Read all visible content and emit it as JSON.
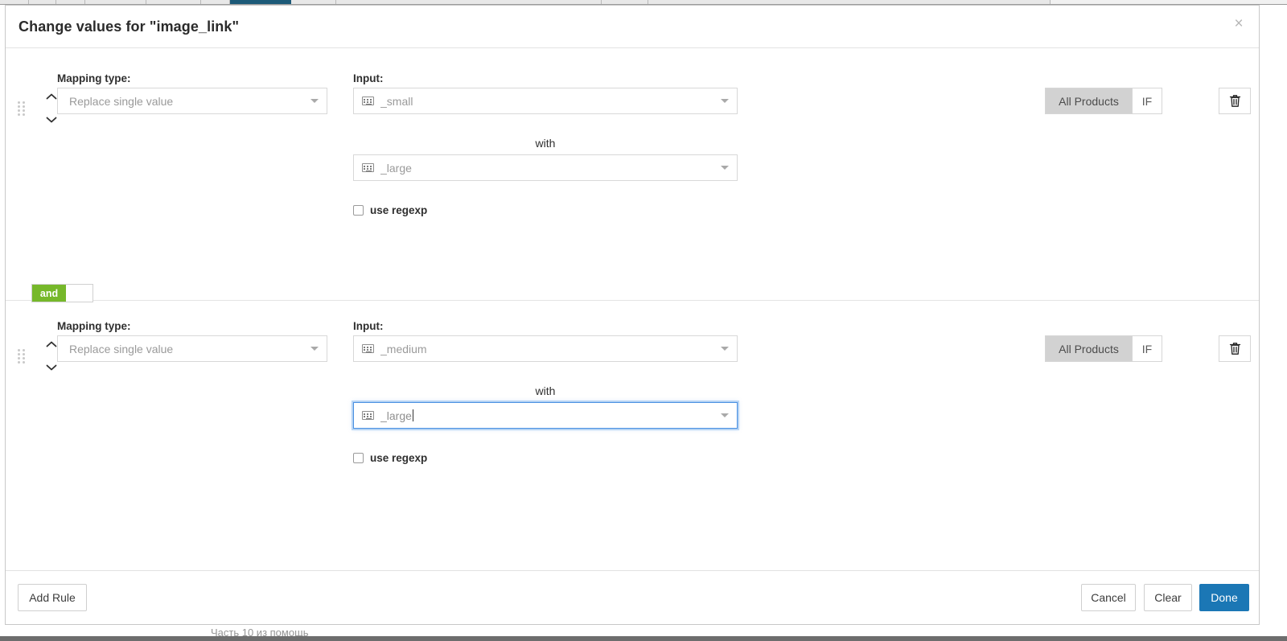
{
  "window": {
    "title": "Change values for \"image_link\"",
    "close_label": "×"
  },
  "labels": {
    "mapping_type": "Mapping type:",
    "input": "Input:",
    "with": "with",
    "use_regexp": "use regexp"
  },
  "rules": [
    {
      "mapping_type": "Replace single value",
      "input_value": "_small",
      "with_value": "_large",
      "use_regexp_checked": false,
      "scope_all_label": "All Products",
      "scope_if_label": "IF",
      "scope_active": "All Products",
      "focused": false
    },
    {
      "mapping_type": "Replace single value",
      "input_value": "_medium",
      "with_value": "_large",
      "use_regexp_checked": false,
      "scope_all_label": "All Products",
      "scope_if_label": "IF",
      "scope_active": "All Products",
      "focused": true
    }
  ],
  "connector": {
    "and_label": "and",
    "or_label": ""
  },
  "footer": {
    "add_rule": "Add Rule",
    "cancel": "Cancel",
    "clear": "Clear",
    "done": "Done"
  },
  "background": {
    "bottom_text": "Часть 10 из помощь"
  },
  "colors": {
    "accent_blue": "#1b77b5",
    "focus_blue": "#4a90e2",
    "and_green": "#76b82a",
    "segment_active": "#d2d2d2"
  }
}
